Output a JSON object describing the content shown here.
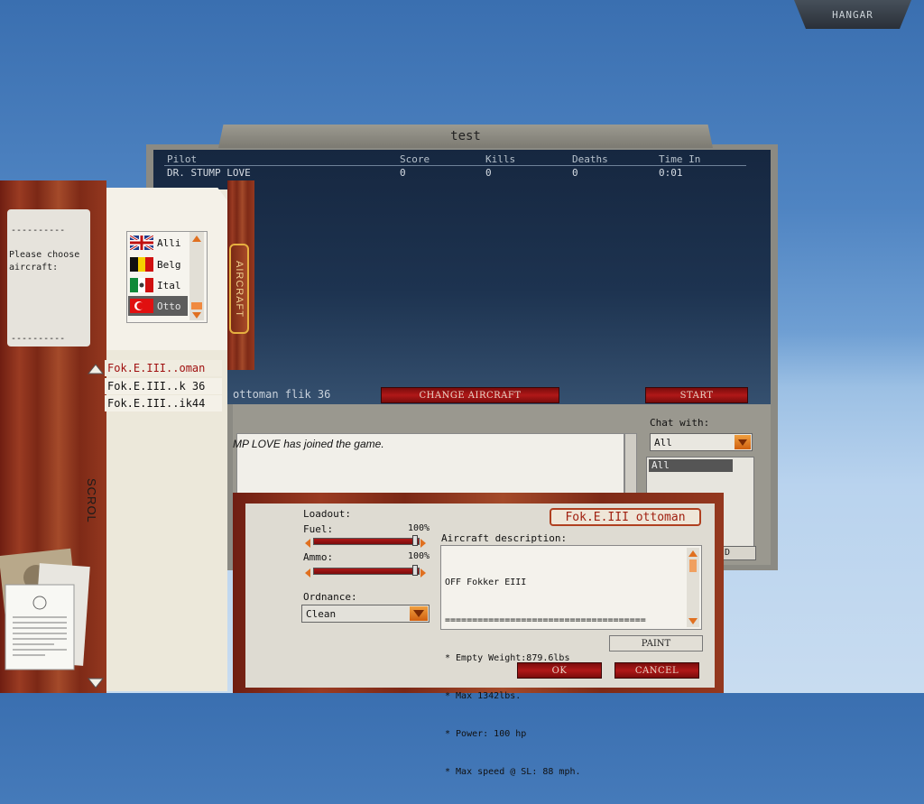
{
  "hangar": {
    "label": "HANGAR"
  },
  "scoreboard": {
    "title": "test",
    "columns": [
      "Pilot",
      "Score",
      "Kills",
      "Deaths",
      "Time In"
    ],
    "rows": [
      [
        "DR. STUMP LOVE",
        "0",
        "0",
        "0",
        "0:01"
      ]
    ],
    "aircraft_name": "ottoman flik 36",
    "change_aircraft_label": "CHANGE AIRCRAFT",
    "start_label": "START"
  },
  "chat": {
    "message": "MP LOVE has joined the game.",
    "with_label": "Chat with:",
    "with_value": "All",
    "list_selected": "All",
    "partial_button": "D"
  },
  "left_panel": {
    "note_dashes_top": "----------",
    "note_text": "Please choose aircraft:",
    "note_dashes_bottom": "----------",
    "aircraft_tab": "AIRCRAFT",
    "scroll_label": "SCROL",
    "nations": [
      {
        "label": "Alli",
        "flag": "uk"
      },
      {
        "label": "Belg",
        "flag": "belgium"
      },
      {
        "label": "Ital",
        "flag": "italy"
      },
      {
        "label": "Otto",
        "flag": "ottoman"
      }
    ],
    "aircraft_list": [
      "Fok.E.III..oman",
      "Fok.E.III..k 36",
      "Fok.E.III..ik44"
    ]
  },
  "loadout": {
    "title": "Loadout:",
    "aircraft_name": "Fok.E.III ottoman",
    "fuel_label": "Fuel:",
    "fuel_value": "100%",
    "fuel_level": 1.0,
    "ammo_label": "Ammo:",
    "ammo_value": "100%",
    "ammo_level": 1.0,
    "ordnance_label": "Ordnance:",
    "ordnance_value": "Clean",
    "description_label": "Aircraft description:",
    "description_lines": [
      "OFF Fokker EIII",
      "=====================================",
      "* Empty Weight:879.6lbs",
      "* Max 1342lbs.",
      "* Power: 100 hp",
      "* Max speed @ SL: 88 mph."
    ],
    "paint_label": "PAINT",
    "ok_label": "OK",
    "cancel_label": "CANCEL"
  },
  "colors": {
    "accent_red": "#b01818",
    "orange_arrow": "#e07020",
    "wood": "#8a3018"
  }
}
